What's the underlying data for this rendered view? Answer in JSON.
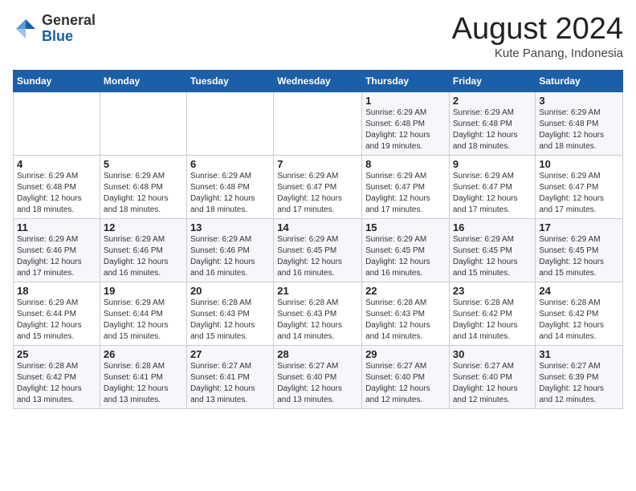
{
  "header": {
    "logo": {
      "general": "General",
      "blue": "Blue"
    },
    "title": "August 2024",
    "subtitle": "Kute Panang, Indonesia"
  },
  "weekdays": [
    "Sunday",
    "Monday",
    "Tuesday",
    "Wednesday",
    "Thursday",
    "Friday",
    "Saturday"
  ],
  "weeks": [
    [
      null,
      null,
      null,
      null,
      {
        "day": "1",
        "sunrise": "6:29 AM",
        "sunset": "6:48 PM",
        "daylight": "12 hours and 19 minutes."
      },
      {
        "day": "2",
        "sunrise": "6:29 AM",
        "sunset": "6:48 PM",
        "daylight": "12 hours and 18 minutes."
      },
      {
        "day": "3",
        "sunrise": "6:29 AM",
        "sunset": "6:48 PM",
        "daylight": "12 hours and 18 minutes."
      }
    ],
    [
      {
        "day": "4",
        "sunrise": "6:29 AM",
        "sunset": "6:48 PM",
        "daylight": "12 hours and 18 minutes."
      },
      {
        "day": "5",
        "sunrise": "6:29 AM",
        "sunset": "6:48 PM",
        "daylight": "12 hours and 18 minutes."
      },
      {
        "day": "6",
        "sunrise": "6:29 AM",
        "sunset": "6:48 PM",
        "daylight": "12 hours and 18 minutes."
      },
      {
        "day": "7",
        "sunrise": "6:29 AM",
        "sunset": "6:47 PM",
        "daylight": "12 hours and 17 minutes."
      },
      {
        "day": "8",
        "sunrise": "6:29 AM",
        "sunset": "6:47 PM",
        "daylight": "12 hours and 17 minutes."
      },
      {
        "day": "9",
        "sunrise": "6:29 AM",
        "sunset": "6:47 PM",
        "daylight": "12 hours and 17 minutes."
      },
      {
        "day": "10",
        "sunrise": "6:29 AM",
        "sunset": "6:47 PM",
        "daylight": "12 hours and 17 minutes."
      }
    ],
    [
      {
        "day": "11",
        "sunrise": "6:29 AM",
        "sunset": "6:46 PM",
        "daylight": "12 hours and 17 minutes."
      },
      {
        "day": "12",
        "sunrise": "6:29 AM",
        "sunset": "6:46 PM",
        "daylight": "12 hours and 16 minutes."
      },
      {
        "day": "13",
        "sunrise": "6:29 AM",
        "sunset": "6:46 PM",
        "daylight": "12 hours and 16 minutes."
      },
      {
        "day": "14",
        "sunrise": "6:29 AM",
        "sunset": "6:45 PM",
        "daylight": "12 hours and 16 minutes."
      },
      {
        "day": "15",
        "sunrise": "6:29 AM",
        "sunset": "6:45 PM",
        "daylight": "12 hours and 16 minutes."
      },
      {
        "day": "16",
        "sunrise": "6:29 AM",
        "sunset": "6:45 PM",
        "daylight": "12 hours and 15 minutes."
      },
      {
        "day": "17",
        "sunrise": "6:29 AM",
        "sunset": "6:45 PM",
        "daylight": "12 hours and 15 minutes."
      }
    ],
    [
      {
        "day": "18",
        "sunrise": "6:29 AM",
        "sunset": "6:44 PM",
        "daylight": "12 hours and 15 minutes."
      },
      {
        "day": "19",
        "sunrise": "6:29 AM",
        "sunset": "6:44 PM",
        "daylight": "12 hours and 15 minutes."
      },
      {
        "day": "20",
        "sunrise": "6:28 AM",
        "sunset": "6:43 PM",
        "daylight": "12 hours and 15 minutes."
      },
      {
        "day": "21",
        "sunrise": "6:28 AM",
        "sunset": "6:43 PM",
        "daylight": "12 hours and 14 minutes."
      },
      {
        "day": "22",
        "sunrise": "6:28 AM",
        "sunset": "6:43 PM",
        "daylight": "12 hours and 14 minutes."
      },
      {
        "day": "23",
        "sunrise": "6:28 AM",
        "sunset": "6:42 PM",
        "daylight": "12 hours and 14 minutes."
      },
      {
        "day": "24",
        "sunrise": "6:28 AM",
        "sunset": "6:42 PM",
        "daylight": "12 hours and 14 minutes."
      }
    ],
    [
      {
        "day": "25",
        "sunrise": "6:28 AM",
        "sunset": "6:42 PM",
        "daylight": "12 hours and 13 minutes."
      },
      {
        "day": "26",
        "sunrise": "6:28 AM",
        "sunset": "6:41 PM",
        "daylight": "12 hours and 13 minutes."
      },
      {
        "day": "27",
        "sunrise": "6:27 AM",
        "sunset": "6:41 PM",
        "daylight": "12 hours and 13 minutes."
      },
      {
        "day": "28",
        "sunrise": "6:27 AM",
        "sunset": "6:40 PM",
        "daylight": "12 hours and 13 minutes."
      },
      {
        "day": "29",
        "sunrise": "6:27 AM",
        "sunset": "6:40 PM",
        "daylight": "12 hours and 12 minutes."
      },
      {
        "day": "30",
        "sunrise": "6:27 AM",
        "sunset": "6:40 PM",
        "daylight": "12 hours and 12 minutes."
      },
      {
        "day": "31",
        "sunrise": "6:27 AM",
        "sunset": "6:39 PM",
        "daylight": "12 hours and 12 minutes."
      }
    ]
  ],
  "labels": {
    "sunrise": "Sunrise:",
    "sunset": "Sunset:",
    "daylight": "Daylight:"
  }
}
